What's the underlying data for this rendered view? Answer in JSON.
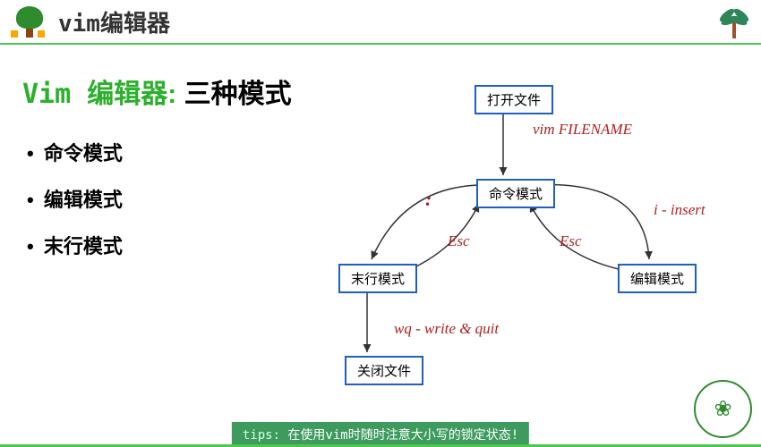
{
  "header": {
    "title": "vim编辑器"
  },
  "heading": {
    "vim": "Vim ",
    "editor": "编辑器",
    "colon": ": ",
    "modes": "三种模式"
  },
  "bullets": [
    "命令模式",
    "编辑模式",
    "末行模式"
  ],
  "diagram": {
    "boxes": {
      "open": "打开文件",
      "cmd": "命令模式",
      "last": "末行模式",
      "edit": "编辑模式",
      "close": "关闭文件"
    },
    "annotations": {
      "vim_cmd": "vim FILENAME",
      "colon": ":",
      "esc1": "Esc",
      "esc2": "Esc",
      "insert": "i - insert",
      "wq": "wq - write & quit"
    }
  },
  "tips": {
    "label": "tips: ",
    "text": "在使用vim时随时注意大小写的锁定状态!"
  }
}
